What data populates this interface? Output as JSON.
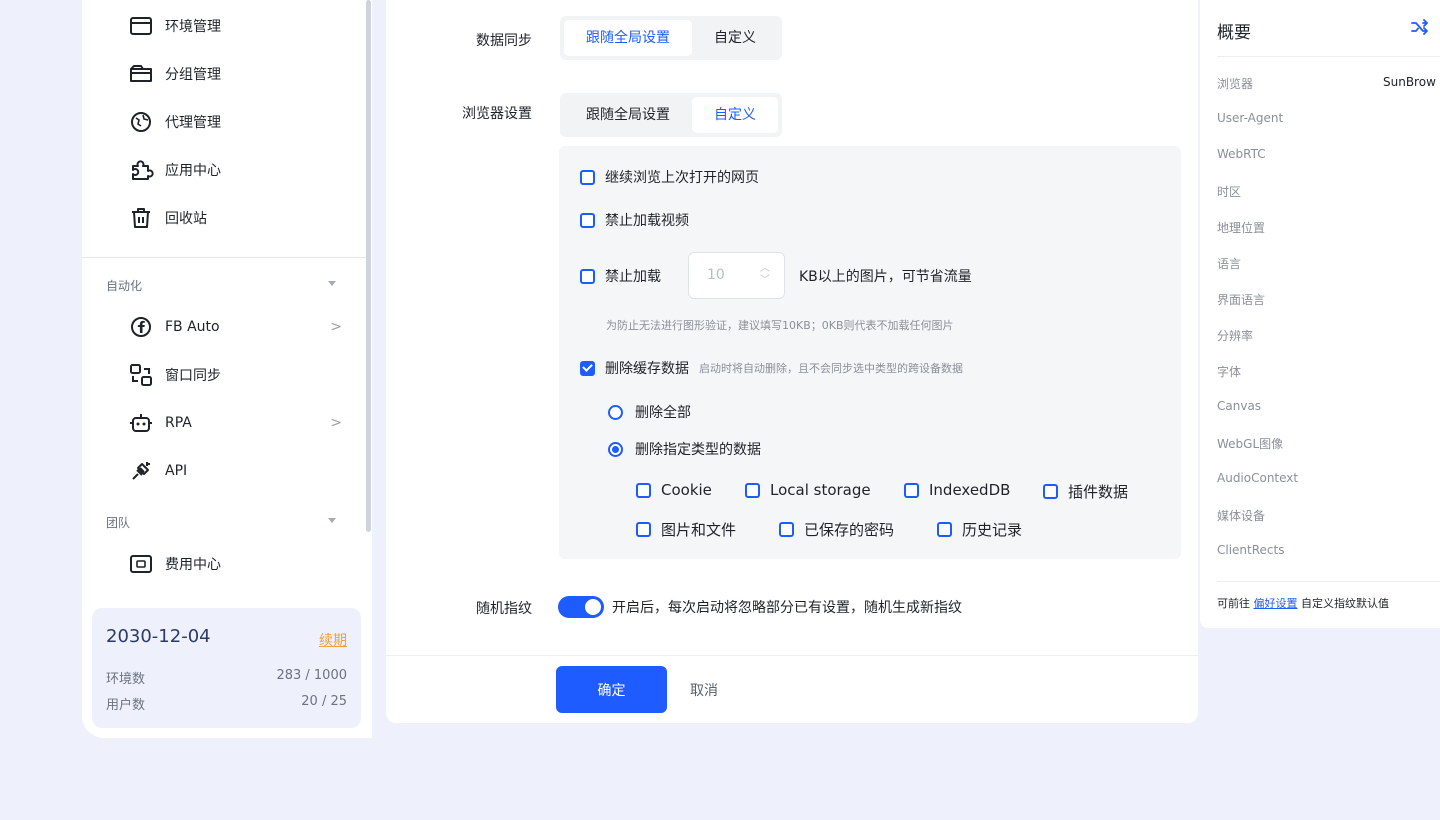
{
  "sidebar": {
    "items_top": [
      {
        "label": "环境管理",
        "icon": "window-icon"
      },
      {
        "label": "分组管理",
        "icon": "folder-icon"
      },
      {
        "label": "代理管理",
        "icon": "proxy-icon"
      },
      {
        "label": "应用中心",
        "icon": "puzzle-icon"
      },
      {
        "label": "回收站",
        "icon": "trash-icon"
      }
    ],
    "group_automation": "自动化",
    "items_automation": [
      {
        "label": "FB Auto",
        "icon": "facebook-icon",
        "chevron": ">"
      },
      {
        "label": "窗口同步",
        "icon": "window-sync-icon",
        "chevron": ""
      },
      {
        "label": "RPA",
        "icon": "robot-icon",
        "chevron": ">"
      },
      {
        "label": "API",
        "icon": "api-plug-icon",
        "chevron": ""
      }
    ],
    "group_team": "团队",
    "items_team": [
      {
        "label": "费用中心",
        "icon": "wallet-icon"
      }
    ],
    "plan": {
      "date": "2030-12-04",
      "renew": "续期",
      "env_label": "环境数",
      "env_value": "283 / 1000",
      "user_label": "用户数",
      "user_value": "20 / 25"
    }
  },
  "form": {
    "data_sync": {
      "label": "数据同步",
      "options": [
        "跟随全局设置",
        "自定义"
      ],
      "selected": "跟随全局设置"
    },
    "browser_settings": {
      "label": "浏览器设置",
      "options": [
        "跟随全局设置",
        "自定义"
      ],
      "selected": "自定义"
    },
    "continue_browsing": {
      "label": "继续浏览上次打开的网页",
      "checked": false
    },
    "block_video": {
      "label": "禁止加载视频",
      "checked": false
    },
    "block_images": {
      "label": "禁止加载",
      "value": "10",
      "suffix": "KB以上的图片，可节省流量",
      "checked": false,
      "hint": "为防止无法进行图形验证，建议填写10KB；0KB则代表不加载任何图片"
    },
    "delete_cache": {
      "label": "删除缓存数据",
      "desc": "启动时将自动删除，且不会同步选中类型的跨设备数据",
      "checked": true
    },
    "delete_mode": {
      "options": [
        "删除全部",
        "删除指定类型的数据"
      ],
      "selected": "删除指定类型的数据"
    },
    "data_types": [
      {
        "label": "Cookie",
        "checked": false
      },
      {
        "label": "Local storage",
        "checked": false
      },
      {
        "label": "IndexedDB",
        "checked": false
      },
      {
        "label": "插件数据",
        "checked": false
      },
      {
        "label": "图片和文件",
        "checked": false
      },
      {
        "label": "已保存的密码",
        "checked": false
      },
      {
        "label": "历史记录",
        "checked": false
      }
    ],
    "random_fingerprint": {
      "label": "随机指纹",
      "enabled": true,
      "desc": "开启后，每次启动将忽略部分已有设置，随机生成新指纹"
    },
    "ok_label": "确定",
    "cancel_label": "取消"
  },
  "overview": {
    "title": "概要",
    "icon": "shuffle-icon",
    "rows": [
      {
        "label": "浏览器",
        "value": "SunBrow"
      },
      {
        "label": "User-Agent",
        "value": ""
      },
      {
        "label": "WebRTC",
        "value": ""
      },
      {
        "label": "时区",
        "value": ""
      },
      {
        "label": "地理位置",
        "value": ""
      },
      {
        "label": "语言",
        "value": ""
      },
      {
        "label": "界面语言",
        "value": ""
      },
      {
        "label": "分辨率",
        "value": ""
      },
      {
        "label": "字体",
        "value": ""
      },
      {
        "label": "Canvas",
        "value": ""
      },
      {
        "label": "WebGL图像",
        "value": ""
      },
      {
        "label": "AudioContext",
        "value": ""
      },
      {
        "label": "媒体设备",
        "value": ""
      },
      {
        "label": "ClientRects",
        "value": ""
      }
    ],
    "footer_prefix": "可前往",
    "footer_link": "偏好设置",
    "footer_suffix": "自定义指纹默认值"
  },
  "colors": {
    "accent": "#1f5cff",
    "background": "#eef0fb",
    "renew": "#f0a23a"
  }
}
